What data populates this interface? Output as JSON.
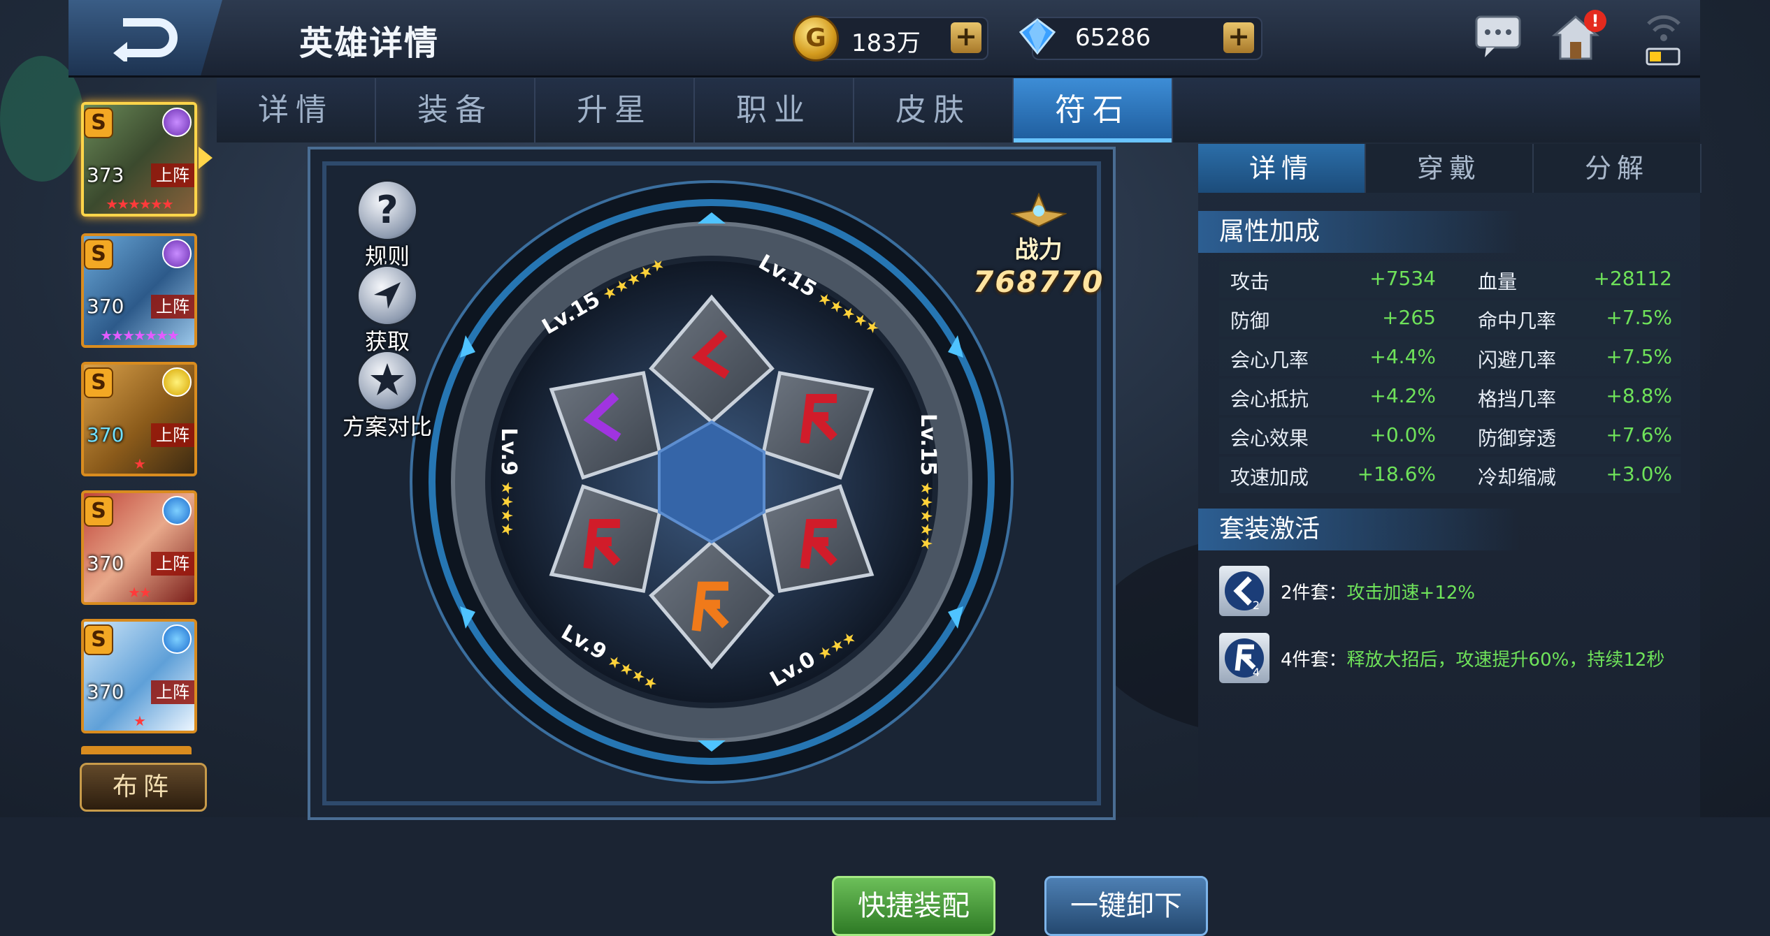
{
  "header": {
    "title": "英雄详情",
    "gold": "183万",
    "gems": "65286",
    "coin_symbol": "G",
    "plus": "+",
    "notification_badge": "!"
  },
  "tabs": [
    {
      "label": "详情"
    },
    {
      "label": "装备"
    },
    {
      "label": "升星"
    },
    {
      "label": "职业"
    },
    {
      "label": "皮肤"
    },
    {
      "label": "符石"
    }
  ],
  "active_tab": 5,
  "heroes": [
    {
      "rank": "S",
      "level": "373",
      "status": "上阵",
      "stars": "★★★★★★",
      "element": "shadow",
      "selected": true
    },
    {
      "rank": "S",
      "level": "370",
      "status": "上阵",
      "stars": "★★★★★★★",
      "element": "shadow"
    },
    {
      "rank": "S",
      "level": "370",
      "status": "上阵",
      "stars": "★",
      "element": "lightning"
    },
    {
      "rank": "S",
      "level": "370",
      "status": "上阵",
      "stars": "★★",
      "element": "water"
    },
    {
      "rank": "S",
      "level": "370",
      "status": "上阵",
      "stars": "★",
      "element": "water"
    }
  ],
  "formation_button": "布阵",
  "rune_panel": {
    "side_buttons": [
      {
        "glyph": "?",
        "label": "规则"
      },
      {
        "glyph": "",
        "label": "获取"
      },
      {
        "glyph": "",
        "label": "方案对比"
      }
    ],
    "power_label": "战力",
    "power_value": "768770",
    "slots": [
      {
        "level": "Lv.15",
        "stars": "★★★★★",
        "rune": "arrow",
        "color": "#d11c2a"
      },
      {
        "level": "Lv.15",
        "stars": "★★★★★",
        "rune": "flag",
        "color": "#d11c2a"
      },
      {
        "level": "Lv.15",
        "stars": "★★★★★",
        "rune": "flag",
        "color": "#d11c2a"
      },
      {
        "level": "Lv.0",
        "stars": "★★★",
        "rune": "flag",
        "color": "#f07a1a"
      },
      {
        "level": "Lv.9",
        "stars": "★★★★",
        "rune": "flag",
        "color": "#d11c2a"
      },
      {
        "level": "Lv.9",
        "stars": "★★★★",
        "rune": "arrow",
        "color": "#a034e0"
      }
    ],
    "quick_equip": "快捷装配",
    "unequip_all": "一键卸下"
  },
  "right_panel": {
    "subtabs": [
      "详情",
      "穿戴",
      "分解"
    ],
    "active_subtab": 0,
    "attr_title": "属性加成",
    "stats": [
      {
        "name": "攻击",
        "value": "+7534",
        "name2": "血量",
        "value2": "+28112"
      },
      {
        "name": "防御",
        "value": "+265",
        "name2": "命中几率",
        "value2": "+7.5%"
      },
      {
        "name": "会心几率",
        "value": "+4.4%",
        "name2": "闪避几率",
        "value2": "+7.5%"
      },
      {
        "name": "会心抵抗",
        "value": "+4.2%",
        "name2": "格挡几率",
        "value2": "+8.8%"
      },
      {
        "name": "会心效果",
        "value": "+0.0%",
        "name2": "防御穿透",
        "value2": "+7.6%"
      },
      {
        "name": "攻速加成",
        "value": "+18.6%",
        "name2": "冷却缩减",
        "value2": "+3.0%"
      }
    ],
    "set_title": "套装激活",
    "sets": [
      {
        "pieces": "2件套：",
        "effect": "攻击加速+12%",
        "icon_num": "2"
      },
      {
        "pieces": "4件套：",
        "effect": "释放大招后，攻速提升60%，持续12秒",
        "icon_num": "4"
      }
    ]
  },
  "colors": {
    "accent": "#2e7cc4",
    "stat_value": "#6fe35a",
    "rune_red": "#d11c2a",
    "rune_orange": "#f07a1a",
    "rune_purple": "#a034e0",
    "gold": "#ffb52a"
  }
}
